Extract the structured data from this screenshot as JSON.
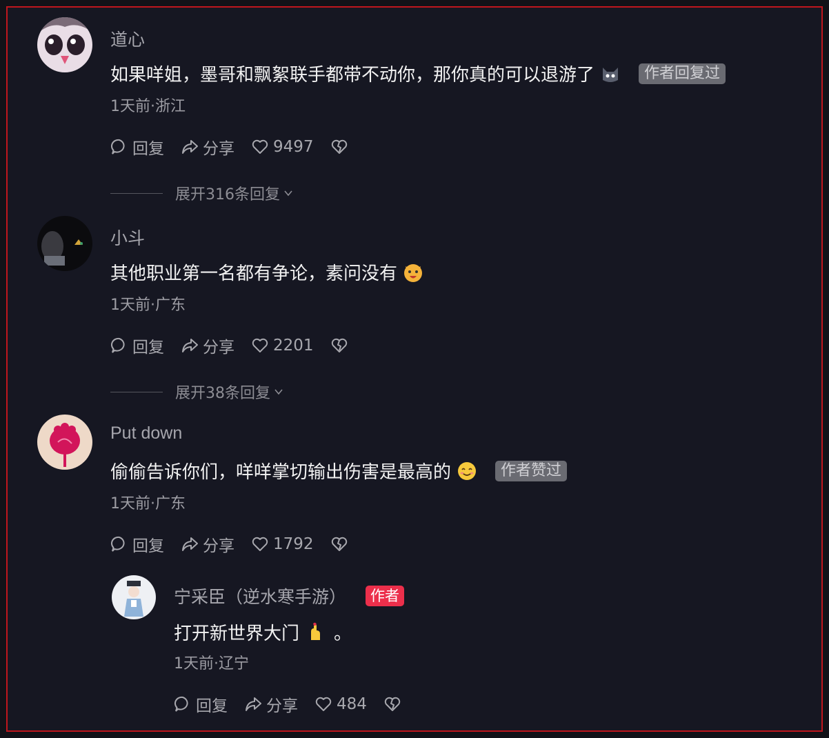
{
  "comments": [
    {
      "username": "道心",
      "text": "如果咩姐，墨哥和飘絮联手都带不动你，那你真的可以退游了",
      "emoji": "cat-emoji",
      "badge": "作者回复过",
      "meta": "1天前·浙江",
      "reply_label": "回复",
      "share_label": "分享",
      "likes": "9497",
      "expand_label": "展开316条回复"
    },
    {
      "username": "小斗",
      "text": "其他职业第一名都有争论，素问没有",
      "emoji": "tiger-emoji",
      "meta": "1天前·广东",
      "reply_label": "回复",
      "share_label": "分享",
      "likes": "2201",
      "expand_label": "展开38条回复"
    },
    {
      "username": "Put down",
      "text": "偷偷告诉你们，咩咩掌切输出伤害是最高的",
      "emoji": "smile-emoji",
      "badge": "作者赞过",
      "meta": "1天前·广东",
      "reply_label": "回复",
      "share_label": "分享",
      "likes": "1792"
    }
  ],
  "reply": {
    "username": "宁采臣（逆水寒手游）",
    "author_tag": "作者",
    "text": "打开新世界大门",
    "text_suffix": "。",
    "emoji": "finger-heart-emoji",
    "meta": "1天前·辽宁",
    "reply_label": "回复",
    "share_label": "分享",
    "likes": "484"
  },
  "colors": {
    "background": "#161722",
    "frame_border": "#c0161d",
    "author_tag": "#ec2f4b",
    "badge": "#6a6b72"
  }
}
